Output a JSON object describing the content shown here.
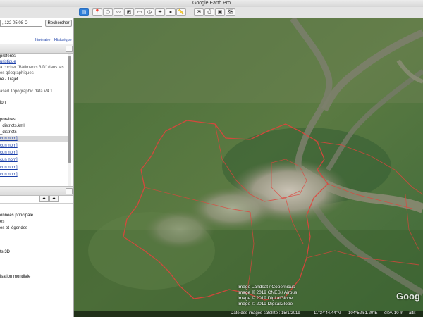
{
  "window": {
    "title": "Google Earth Pro"
  },
  "toolbar": {
    "buttons": [
      {
        "name": "sidebar-toggle",
        "icon": "sidebar-icon"
      },
      {
        "name": "add-placemark",
        "icon": "pushpin-icon"
      },
      {
        "name": "add-polygon",
        "icon": "polygon-icon"
      },
      {
        "name": "add-path",
        "icon": "path-icon"
      },
      {
        "name": "add-overlay",
        "icon": "overlay-icon"
      },
      {
        "name": "record-tour",
        "icon": "tour-icon"
      },
      {
        "name": "historical-imagery",
        "icon": "clock-icon"
      },
      {
        "name": "sunlight",
        "icon": "sun-icon"
      },
      {
        "name": "planets",
        "icon": "planet-icon"
      },
      {
        "name": "ruler",
        "icon": "ruler-icon"
      },
      {
        "name": "email",
        "icon": "mail-icon"
      },
      {
        "name": "print",
        "icon": "print-icon"
      },
      {
        "name": "save-image",
        "icon": "image-icon"
      },
      {
        "name": "google-maps",
        "icon": "map-icon"
      }
    ]
  },
  "search": {
    "value": ", 122 05 08 O",
    "button": "Rechercher",
    "links": [
      "Itinéraire",
      "Historique"
    ]
  },
  "places": {
    "items": [
      {
        "label": "préférés",
        "style": ""
      },
      {
        "label": "uristique",
        "style": "link"
      },
      {
        "label": "à cocher \"Bâtiments 3 D\" dans les",
        "style": "grey"
      },
      {
        "label": "es géographiques",
        "style": "grey"
      },
      {
        "label": "re - Trajet",
        "style": ""
      },
      {
        "label": "",
        "style": ""
      },
      {
        "label": "ased Topographic data V4.1.",
        "style": "grey"
      },
      {
        "label": "",
        "style": ""
      },
      {
        "label": "ion",
        "style": ""
      },
      {
        "label": "",
        "style": ""
      },
      {
        "label": "",
        "style": ""
      },
      {
        "label": "poraires",
        "style": ""
      },
      {
        "label": "_districts.kml",
        "style": ""
      },
      {
        "label": "_districts",
        "style": ""
      },
      {
        "label": "cun nom]",
        "style": "link hl"
      },
      {
        "label": "cun nom]",
        "style": "link"
      },
      {
        "label": "cun nom]",
        "style": "link"
      },
      {
        "label": "cun nom]",
        "style": "link"
      },
      {
        "label": "cun nom]",
        "style": "link"
      },
      {
        "label": "cun nom]",
        "style": "link"
      }
    ]
  },
  "layers": {
    "items": [
      {
        "label": "onnées principale"
      },
      {
        "label": "es"
      },
      {
        "label": "es et légendes"
      },
      {
        "label": ""
      },
      {
        "label": ""
      },
      {
        "label": "ts 3D"
      },
      {
        "label": ""
      },
      {
        "label": ""
      },
      {
        "label": ""
      },
      {
        "label": "isation mondiale"
      }
    ]
  },
  "map": {
    "attribution": [
      "Image Landsat / Copernicus",
      "Image © 2019 CNES / Airbus",
      "Image © 2019 DigitalGlobe",
      "Image © 2019 DigitalGlobe"
    ],
    "status": {
      "date": "Date des images satellite : 15/1/2019",
      "lat": "11°34'44.44\"N",
      "lon": "104°52'51.20\"E",
      "elev": "élév. 10 m",
      "alt": "altit"
    },
    "logo": "Goog"
  },
  "colors": {
    "accent": "#2f7fd9",
    "boundary": "#e0443c"
  }
}
